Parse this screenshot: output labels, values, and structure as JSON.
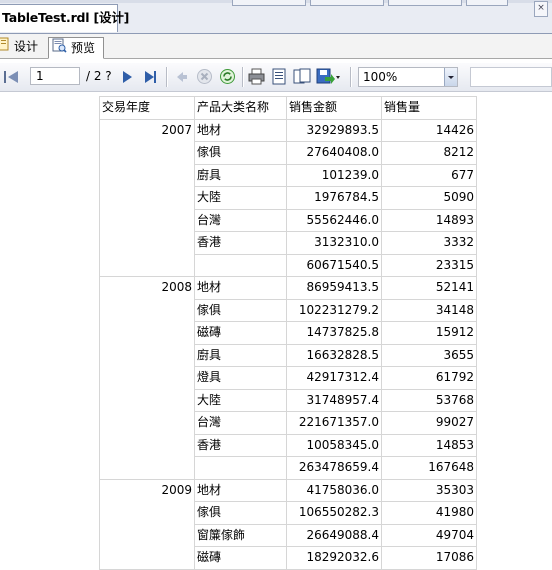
{
  "document_tab": {
    "title": "TableTest.rdl [设计]",
    "close_glyph": "×"
  },
  "sub_tabs": [
    {
      "label": "设计",
      "icon": "design-icon",
      "active": false
    },
    {
      "label": "预览",
      "icon": "preview-icon",
      "active": true
    }
  ],
  "toolbar": {
    "page_current": "1",
    "page_total": "/ 2 ?",
    "zoom": "100%",
    "icons": [
      "first-page-icon",
      "previous-page-icon",
      "next-page-icon",
      "last-page-icon",
      "back-icon",
      "stop-icon",
      "refresh-icon",
      "print-icon",
      "print-layout-icon",
      "page-setup-icon",
      "export-icon"
    ]
  },
  "report": {
    "headers": [
      "交易年度",
      "产品大类名称",
      "销售金额",
      "销售量"
    ],
    "groups": [
      {
        "year": "2007",
        "rows": [
          [
            "地材",
            "32929893.5",
            "14426"
          ],
          [
            "傢俱",
            "27640408.0",
            "8212"
          ],
          [
            "廚具",
            "101239.0",
            "677"
          ],
          [
            "大陸",
            "1976784.5",
            "5090"
          ],
          [
            "台灣",
            "55562446.0",
            "14893"
          ],
          [
            "香港",
            "3132310.0",
            "3332"
          ]
        ],
        "subtotal": [
          "",
          "60671540.5",
          "23315"
        ]
      },
      {
        "year": "2008",
        "rows": [
          [
            "地材",
            "86959413.5",
            "52141"
          ],
          [
            "傢俱",
            "102231279.2",
            "34148"
          ],
          [
            "磁磚",
            "14737825.8",
            "15912"
          ],
          [
            "廚具",
            "16632828.5",
            "3655"
          ],
          [
            "燈具",
            "42917312.4",
            "61792"
          ],
          [
            "大陸",
            "31748957.4",
            "53768"
          ],
          [
            "台灣",
            "221671357.0",
            "99027"
          ],
          [
            "香港",
            "10058345.0",
            "14853"
          ]
        ],
        "subtotal": [
          "",
          "263478659.4",
          "167648"
        ]
      },
      {
        "year": "2009",
        "rows": [
          [
            "地材",
            "41758036.0",
            "35303"
          ],
          [
            "傢俱",
            "106550282.3",
            "41980"
          ],
          [
            "窗簾傢飾",
            "26649088.4",
            "49704"
          ],
          [
            "磁磚",
            "18292032.6",
            "17086"
          ]
        ],
        "subtotal": null
      }
    ]
  }
}
